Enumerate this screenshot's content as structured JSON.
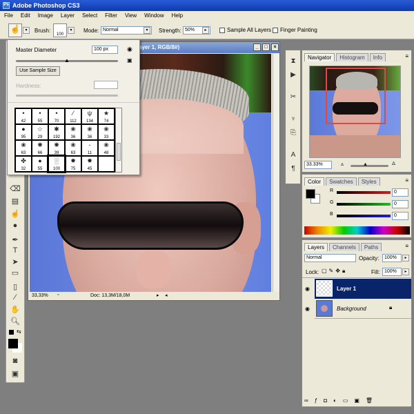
{
  "app": {
    "title": "Adobe Photoshop CS3",
    "icon": "Ps"
  },
  "menu": [
    "File",
    "Edit",
    "Image",
    "Layer",
    "Select",
    "Filter",
    "View",
    "Window",
    "Help"
  ],
  "options": {
    "brush_label": "Brush:",
    "brush_size": "100",
    "mode_label": "Mode:",
    "mode_value": "Normal",
    "strength_label": "Strength:",
    "strength_value": "50%",
    "sample_all": "Sample All Layers",
    "finger": "Finger Painting"
  },
  "brush_panel": {
    "master_diameter_label": "Master Diameter",
    "master_diameter_value": "100 px",
    "master_diameter_fraction": 0.5,
    "use_sample_size": "Use Sample Size",
    "hardness_label": "Hardness:",
    "hardness_value": "",
    "brushes": [
      {
        "n": "42",
        "g": "•"
      },
      {
        "n": "55",
        "g": "•"
      },
      {
        "n": "70",
        "g": "•"
      },
      {
        "n": "112",
        "g": "⁄"
      },
      {
        "n": "134",
        "g": "ψ"
      },
      {
        "n": "74",
        "g": "★"
      },
      {
        "n": "95",
        "g": "●"
      },
      {
        "n": "29",
        "g": "☆"
      },
      {
        "n": "192",
        "g": "✱"
      },
      {
        "n": "36",
        "g": "❀"
      },
      {
        "n": "36",
        "g": "❀"
      },
      {
        "n": "33",
        "g": "❀"
      },
      {
        "n": "63",
        "g": "❀"
      },
      {
        "n": "66",
        "g": "✺"
      },
      {
        "n": "39",
        "g": "✺"
      },
      {
        "n": "63",
        "g": "❀"
      },
      {
        "n": "11",
        "g": "-"
      },
      {
        "n": "48",
        "g": "❀"
      },
      {
        "n": "32",
        "g": "✤"
      },
      {
        "n": "55",
        "g": "●"
      },
      {
        "n": "100",
        "g": "░"
      },
      {
        "n": "75",
        "g": "✹"
      },
      {
        "n": "45",
        "g": "✹"
      },
      {
        "n": "",
        "g": ""
      }
    ],
    "selected_index": 20
  },
  "document": {
    "title": "ayer 1, RGB/8#)",
    "zoom": "33,33%",
    "doc_info": "Doc: 13,3M/18,0M"
  },
  "navigator": {
    "tabs": [
      "Navigator",
      "Histogram",
      "Info"
    ],
    "zoom": "33.33%"
  },
  "color": {
    "tabs": [
      "Color",
      "Swatches",
      "Styles"
    ],
    "channels": [
      {
        "label": "R",
        "value": "0",
        "color": "#d02020"
      },
      {
        "label": "G",
        "value": "0",
        "color": "#20c020"
      },
      {
        "label": "B",
        "value": "0",
        "color": "#2020d0"
      }
    ]
  },
  "layers": {
    "tabs": [
      "Layers",
      "Channels",
      "Paths"
    ],
    "blend": "Normal",
    "opacity_label": "Opacity:",
    "opacity": "100%",
    "lock_label": "Lock:",
    "fill_label": "Fill:",
    "fill": "100%",
    "items": [
      {
        "name": "Layer 1",
        "selected": true
      },
      {
        "name": "Background",
        "selected": false,
        "locked": true
      }
    ]
  },
  "colors": {
    "selection": "#0a246a",
    "titlebar": "#0b3ab0"
  }
}
